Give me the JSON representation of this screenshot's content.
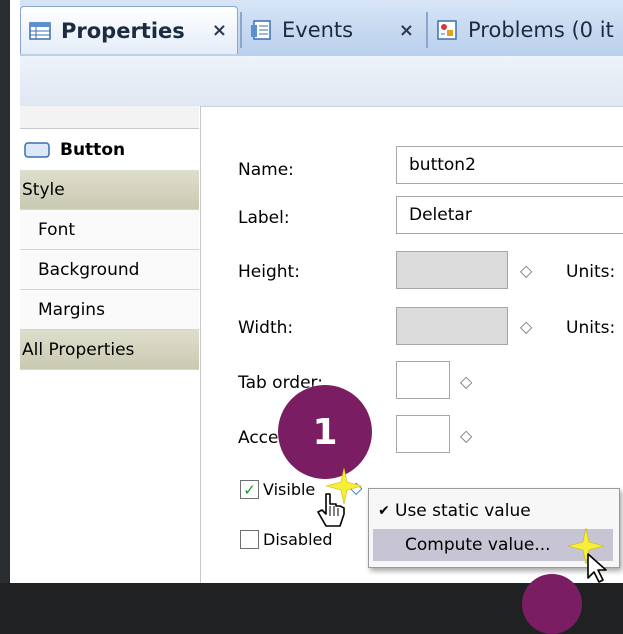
{
  "tabs": [
    {
      "label": "Properties",
      "close": "×",
      "icon": "properties-table-icon",
      "active": true
    },
    {
      "label": "Events",
      "close": "×",
      "icon": "events-list-icon",
      "active": false
    },
    {
      "label": "Problems (0 it",
      "icon": "problems-icon",
      "active": false
    }
  ],
  "sidebar": {
    "title": "Button",
    "title_icon": "button-widget-icon",
    "items": [
      {
        "label": "Style",
        "kind": "header"
      },
      {
        "label": "Font",
        "kind": "sub"
      },
      {
        "label": "Background",
        "kind": "sub"
      },
      {
        "label": "Margins",
        "kind": "sub"
      },
      {
        "label": "All Properties",
        "kind": "header"
      }
    ]
  },
  "form": {
    "name_label": "Name:",
    "name_value": "button2",
    "label_label": "Label:",
    "label_value": "Deletar",
    "height_label": "Height:",
    "width_label": "Width:",
    "units_label": "Units:",
    "tab_order_label": "Tab order:",
    "accel_label": "Acce",
    "visible_label": "Visible",
    "visible_checked": true,
    "disabled_label": "Disabled",
    "disabled_checked": false,
    "diamond": "◇",
    "checkmark": "✓"
  },
  "context_menu": {
    "items": [
      {
        "label": "Use static value",
        "checked": true,
        "mark": "✔"
      },
      {
        "label": "Compute value...",
        "checked": false,
        "highlighted": true
      }
    ]
  },
  "annotations": {
    "step_badge": "1",
    "accent_color": "#7b1d63",
    "sparkle_color": "#f5ef3a"
  }
}
